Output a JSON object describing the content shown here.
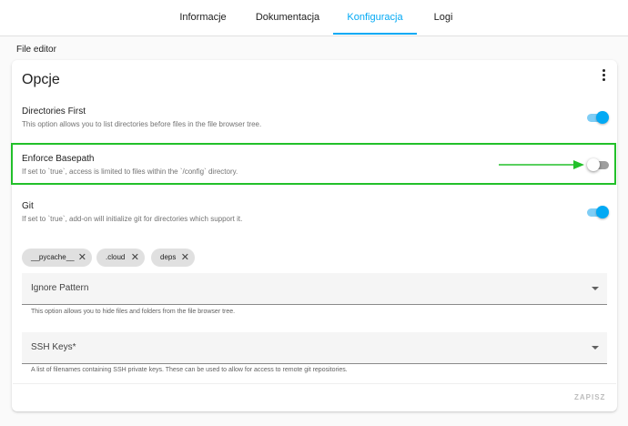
{
  "tabs": [
    {
      "label": "Informacje"
    },
    {
      "label": "Dokumentacja"
    },
    {
      "label": "Konfiguracja",
      "active": true
    },
    {
      "label": "Logi"
    }
  ],
  "section_title": "File editor",
  "card": {
    "title": "Opcje",
    "menu_icon": "more-vertical-icon"
  },
  "options": [
    {
      "title": "Directories First",
      "description": "This option allows you to list directories before files in the file browser tree.",
      "enabled": true
    },
    {
      "title": "Enforce Basepath",
      "description": "If set to `true`, access is limited to files within the `/config` directory.",
      "enabled": false
    },
    {
      "title": "Git",
      "description": "If set to `true`, add-on will initialize git for directories which support it.",
      "enabled": true
    }
  ],
  "chips": [
    {
      "label": "__pycache__"
    },
    {
      "label": ".cloud"
    },
    {
      "label": "deps"
    }
  ],
  "chip_remove_glyph": "✕",
  "ignore_pattern": {
    "label": "Ignore Pattern",
    "helper": "This option allows you to hide files and folders from the file browser tree."
  },
  "ssh_keys": {
    "label": "SSH Keys*",
    "helper": "A list of filenames containing SSH private keys. These can be used to allow for access to remote git repositories."
  },
  "save_label": "ZAPISZ",
  "colors": {
    "accent": "#03a9f4",
    "highlight": "#22c02a"
  }
}
